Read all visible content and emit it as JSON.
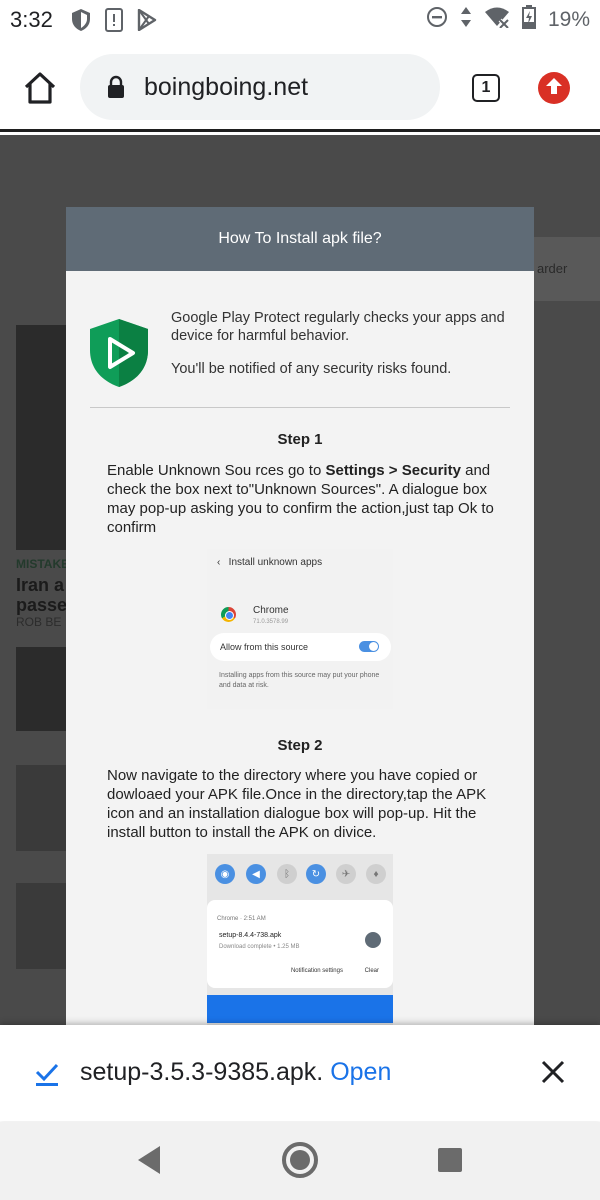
{
  "status": {
    "time": "3:32",
    "battery": "19%",
    "left_icons": [
      "shield-icon",
      "alert-icon",
      "play-store-icon"
    ],
    "right_icons": [
      "dnd-icon",
      "data-arrows-icon",
      "wifi-off-icon",
      "battery-icon"
    ]
  },
  "toolbar": {
    "url": "boingboing.net",
    "tab_count": "1"
  },
  "background_page": {
    "tag": "MISTAKE",
    "headline_1": "Iran a",
    "headline_2": "passe",
    "byline": "ROB BE",
    "ad_text": "arder"
  },
  "dialog": {
    "title": "How To Install apk file?",
    "protect_line_1": "Google Play Protect regularly checks your apps and device for harmful behavior.",
    "protect_line_2": "You'll be notified of any security risks found.",
    "step1": {
      "title": "Step 1",
      "text_a": "Enable Unknown Sou rces go to ",
      "text_bold": "Settings > Security",
      "text_b": " and check the box next to\"Unknown Sources\". A dialogue box may pop-up asking you to confirm the action,just tap Ok to confirm",
      "shot": {
        "title": "Install unknown apps",
        "app_name": "Chrome",
        "app_version": "71.0.3578.99",
        "allow_label": "Allow from this source",
        "note": "Installing apps from this source may put your phone and data at risk."
      }
    },
    "step2": {
      "title": "Step 2",
      "text": "Now navigate to the directory where you have copied or dowloaed your APK file.Once in the directory,tap the APK icon and an installation dialogue box will pop-up. Hit the install button to install the APK on divice.",
      "shot": {
        "source": "Chrome · 2:51 AM",
        "file": "setup-8.4.4-738.apk",
        "sub": "Download complete • 1.25 MB",
        "action_1": "Notification settings",
        "action_2": "Clear"
      }
    }
  },
  "download_bar": {
    "filename": "setup-3.5.3-9385.apk.",
    "open_label": "Open"
  },
  "colors": {
    "dialog_header": "#5f6b76",
    "link_blue": "#1a73e8",
    "update_red": "#d93025",
    "protect_green": "#0f9d58"
  }
}
